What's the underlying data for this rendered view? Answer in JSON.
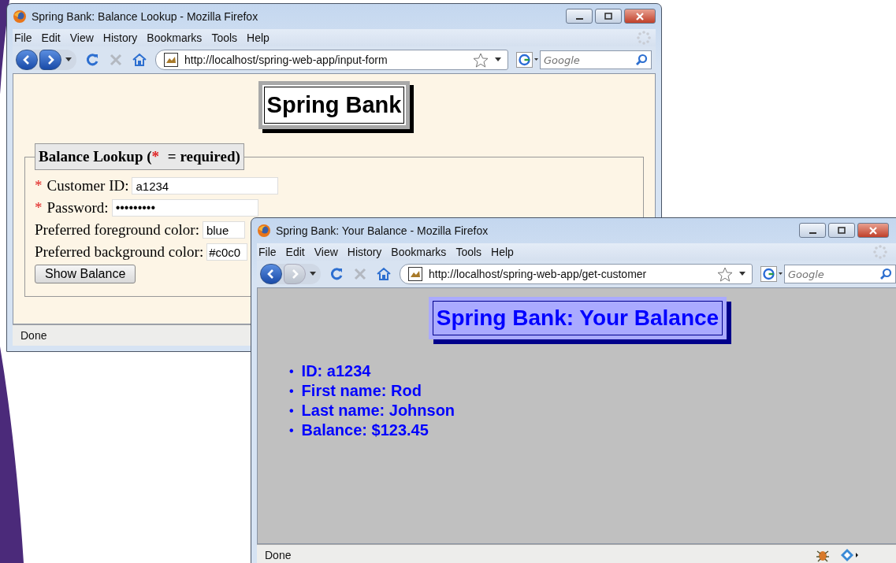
{
  "windows": [
    {
      "kind": "form",
      "title": "Spring Bank: Balance Lookup - Mozilla Firefox",
      "menu": [
        "File",
        "Edit",
        "View",
        "History",
        "Bookmarks",
        "Tools",
        "Help"
      ],
      "forward_disabled": false,
      "url": "http://localhost/spring-web-app/input-form",
      "search": {
        "placeholder": "Google"
      },
      "heading": "Spring Bank",
      "legend": {
        "before": "Balance Lookup (",
        "mark": "*",
        "after": " = required)"
      },
      "fields": [
        {
          "marker": "*",
          "label": "Customer ID:",
          "value": "a1234"
        },
        {
          "marker": "*",
          "label": "Password:",
          "value": "•••••••••"
        },
        {
          "label": "Preferred foreground color:",
          "value": "blue"
        },
        {
          "label": "Preferred background color:",
          "value": "#c0c0"
        }
      ],
      "button": "Show Balance",
      "status": "Done"
    },
    {
      "kind": "result",
      "title": "Spring Bank: Your Balance - Mozilla Firefox",
      "menu": [
        "File",
        "Edit",
        "View",
        "History",
        "Bookmarks",
        "Tools",
        "Help"
      ],
      "forward_disabled": true,
      "url": "http://localhost/spring-web-app/get-customer",
      "search": {
        "placeholder": "Google"
      },
      "heading": "Spring Bank: Your Balance",
      "items": [
        {
          "marker": "•",
          "text": "ID: a1234"
        },
        {
          "marker": "•",
          "text": "First name: Rod"
        },
        {
          "marker": "•",
          "text": "Last name: Johnson"
        },
        {
          "marker": "•",
          "text": "Balance: $123.45"
        }
      ],
      "status": "Done"
    }
  ]
}
